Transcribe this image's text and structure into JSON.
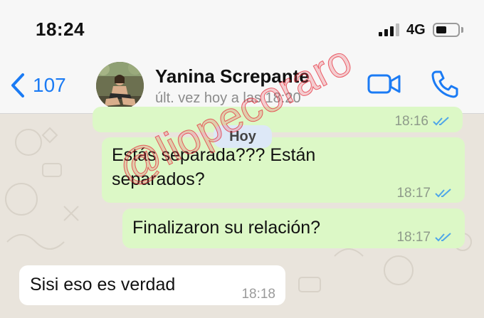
{
  "status_bar": {
    "time": "18:24",
    "network": "4G",
    "battery_level": 0.45
  },
  "header": {
    "back_count": "107",
    "contact_name": "Yanina Screpante",
    "last_seen": "últ. vez hoy a las 18:20",
    "icons": [
      "chevron-left-icon",
      "video-call-icon",
      "phone-icon"
    ],
    "accent_color": "#1b7bf4"
  },
  "chat": {
    "date_label": "Hoy",
    "messages": [
      {
        "text": "",
        "time": "18:16",
        "direction": "out",
        "read": true
      },
      {
        "text": "Estás separada??? Están separados?",
        "time": "18:17",
        "direction": "out",
        "read": true
      },
      {
        "text": "Finalizaron su relación?",
        "time": "18:17",
        "direction": "out",
        "read": true
      },
      {
        "text": "Sisi eso es verdad",
        "time": "18:18",
        "direction": "in"
      }
    ],
    "outgoing_color": "#dcf8c6",
    "incoming_color": "#ffffff",
    "read_tick_color": "#4fa6e8"
  },
  "watermark": "@liopecoraro"
}
